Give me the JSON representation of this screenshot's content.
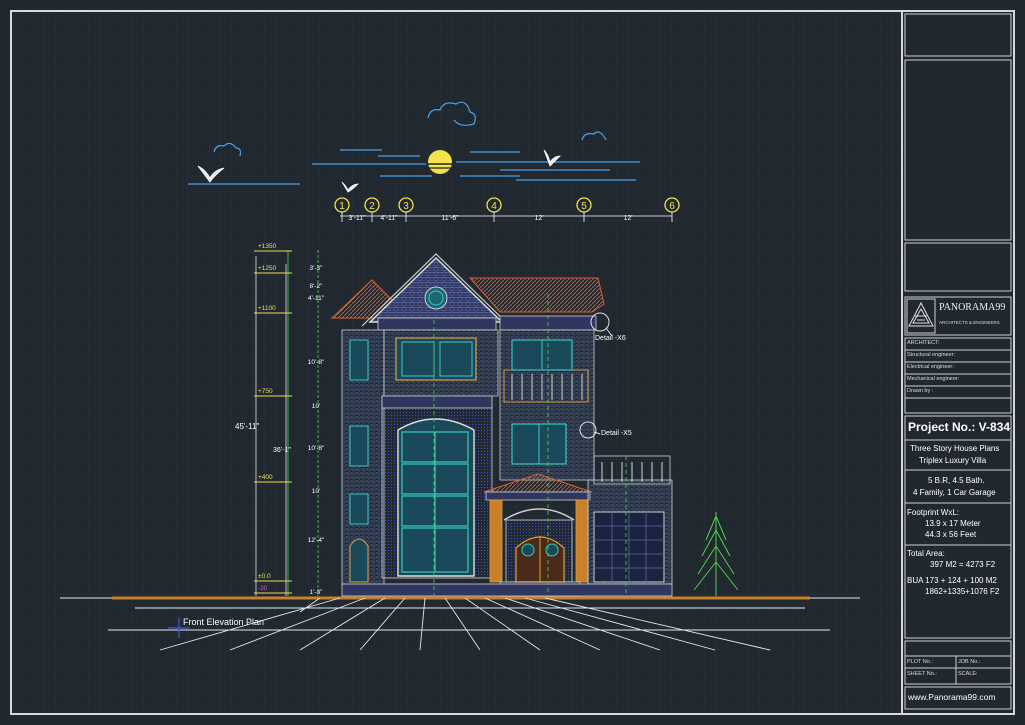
{
  "drawing": {
    "title": "Front Elevation Plan",
    "grid_markers": [
      "1",
      "2",
      "3",
      "4",
      "5",
      "6"
    ],
    "horizontal_dims": [
      "3'-11\"",
      "4'-11\"",
      "11'-6\"",
      "12'",
      "12'"
    ],
    "levels": [
      "+1350",
      "+1250",
      "+1100",
      "+750",
      "+400",
      "±0.0",
      "-30"
    ],
    "vertical_dims": [
      "3'-3\"",
      "8'-2\"",
      "4'-11\"",
      "10'-8\"",
      "10'",
      "10'-8\"",
      "10'",
      "12'-4\"",
      "1'-3\""
    ],
    "overall_height": "45'-11\"",
    "sub_height": "36'-1\"",
    "details": [
      "Detail -X6",
      "Detail -X5"
    ]
  },
  "title_block": {
    "company": "PANORAMA99",
    "company_sub": "ARCHITECTS & ENGINEERS",
    "rows": [
      "ARCHITECT:",
      "Structural engineer:",
      "Electrical engineer:",
      "Mechanical engineer:",
      "Drawn by :"
    ],
    "project_no": "Project No.: V-834",
    "desc1": "Three Story House Plans",
    "desc2": "Triplex Luxury Villa",
    "spec1": "5 B.R, 4.5 Bath.",
    "spec2": "4 Family, 1 Car Garage",
    "footprint_label": "Footprint WxL:",
    "footprint_m": "13.9 x 17 Meter",
    "footprint_ft": "44.3 x 56 Feet",
    "area_label": "Total Area:",
    "area_total": "397 M2 = 4273 F2",
    "bua1": "BUA 173 + 124 + 100 M2",
    "bua2": "1862+1335+1076 F2",
    "plot_no": "PLOT No.:",
    "job_no": "JOB No.:",
    "sheet_no": "SHEET No.:",
    "scale": "SCALE:",
    "website": "www.Panorama99.com"
  },
  "colors": {
    "background": "#212830",
    "border": "#d8d8d8",
    "roof": "#c8502a",
    "window": "#36c9c6",
    "wall_blue": "#3546b8",
    "dim_green": "#4ad04a",
    "level_yellow": "#e8e050",
    "sky": "#4aa0e8"
  }
}
